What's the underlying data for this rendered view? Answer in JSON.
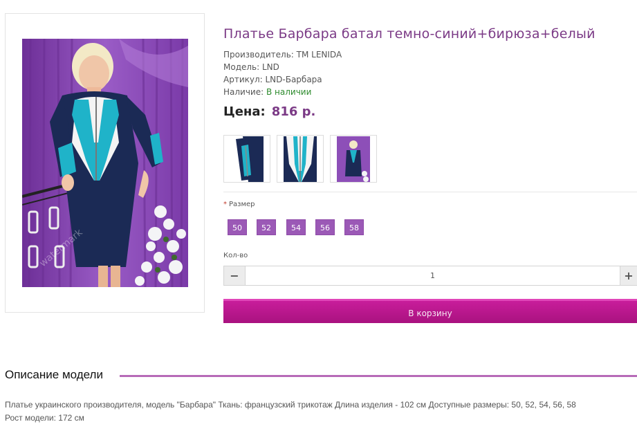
{
  "product": {
    "title": "Платье Барбара батал темно-синий+бирюза+белый",
    "manufacturer": "Производитель: TM LENIDA",
    "model": "Модель: LND",
    "sku": "Артикул: LND-Барбара",
    "availability_label": "Наличие:",
    "availability_value": "В наличии",
    "price_label": "Цена:",
    "price_value": "816 р."
  },
  "options": {
    "required_marker": "*",
    "size_label": "Размер",
    "sizes": [
      "50",
      "52",
      "54",
      "56",
      "58"
    ],
    "quantity_label": "Кол-во",
    "quantity_value": "1",
    "minus_label": "−",
    "plus_label": "+",
    "add_to_cart_label": "В корзину"
  },
  "description": {
    "heading": "Описание модели",
    "line1": "Платье украинского производителя, модель \"Барбара\" Ткань: французский трикотаж Длина изделия - 102 см Доступные размеры: 50, 52, 54, 56, 58",
    "line2": "Рост модели: 172 см"
  },
  "colors": {
    "accent_purple": "#7b3a86",
    "size_button": "#9b59b6",
    "cart_button": "#b8168c",
    "dress_navy": "#1b2a55",
    "dress_turquoise": "#1fb3c9",
    "curtain_violet": "#8d4fb8"
  },
  "icons": {
    "minus": "minus-icon",
    "plus": "plus-icon"
  }
}
